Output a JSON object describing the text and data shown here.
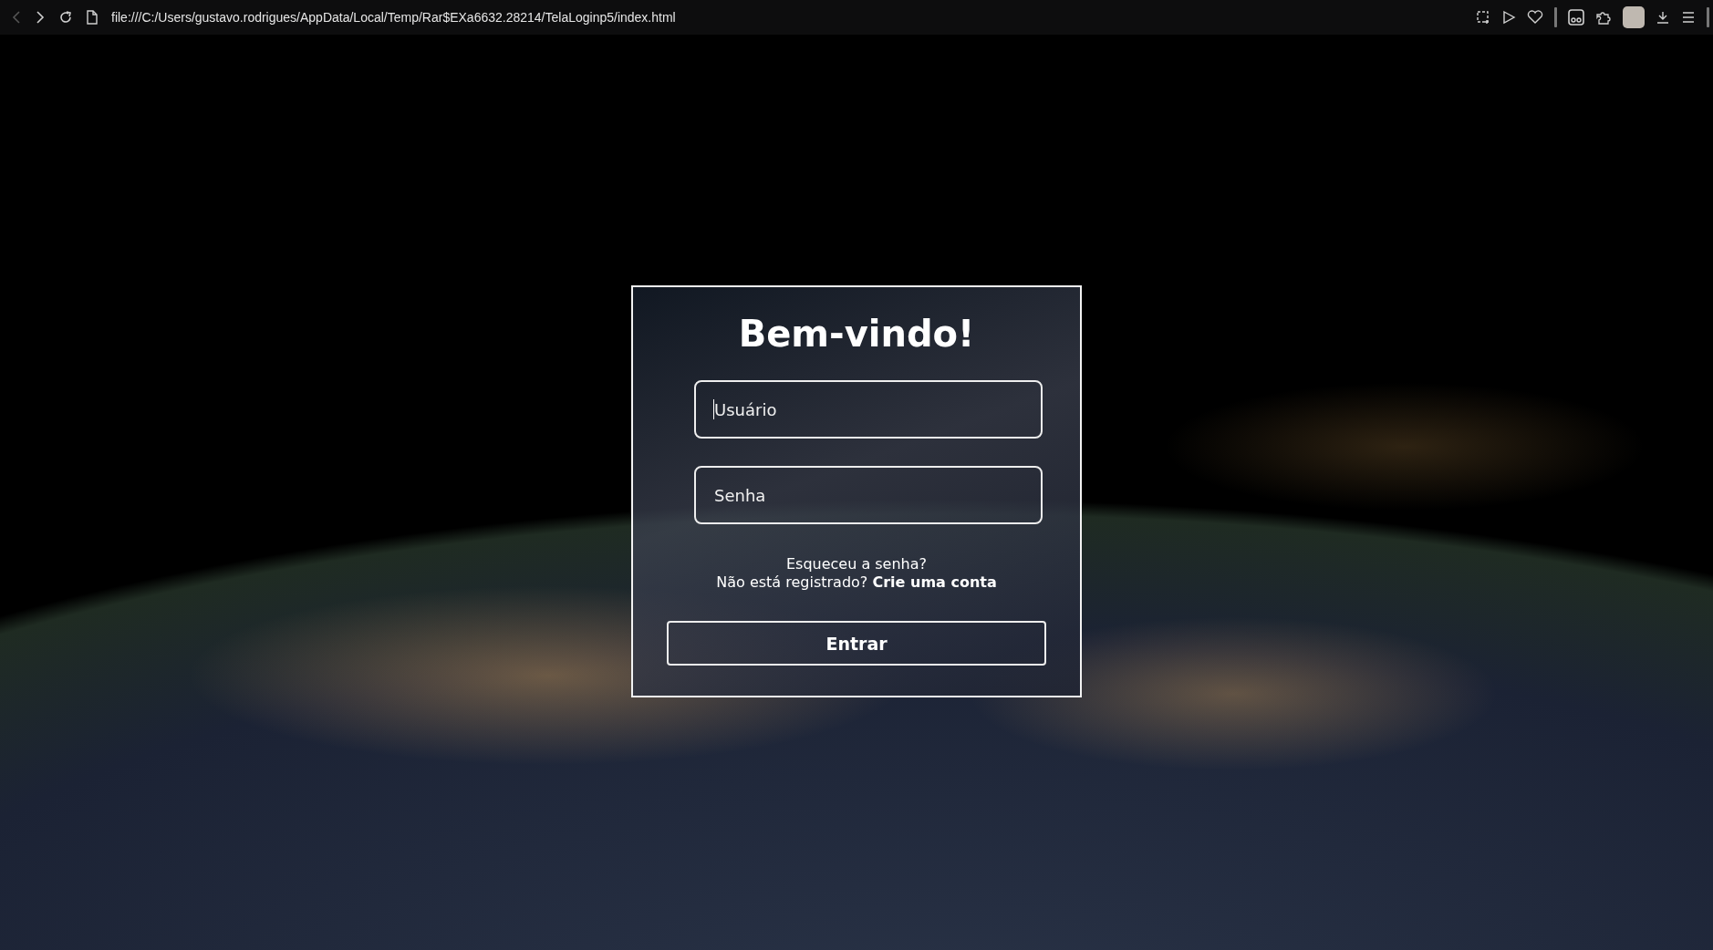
{
  "browser": {
    "address": "file:///C:/Users/gustavo.rodrigues/AppData/Local/Temp/Rar$EXa6632.28214/TelaLoginp5/index.html",
    "back_disabled": true
  },
  "login": {
    "title": "Bem-vindo!",
    "fields": [
      {
        "placeholder": "Usuário",
        "focused": true
      },
      {
        "placeholder": "Senha",
        "focused": false
      }
    ],
    "forgot_link": "Esqueceu a senha?",
    "register_prompt": "Não está registrado?",
    "register_link": "Crie uma conta",
    "submit": "Entrar"
  }
}
